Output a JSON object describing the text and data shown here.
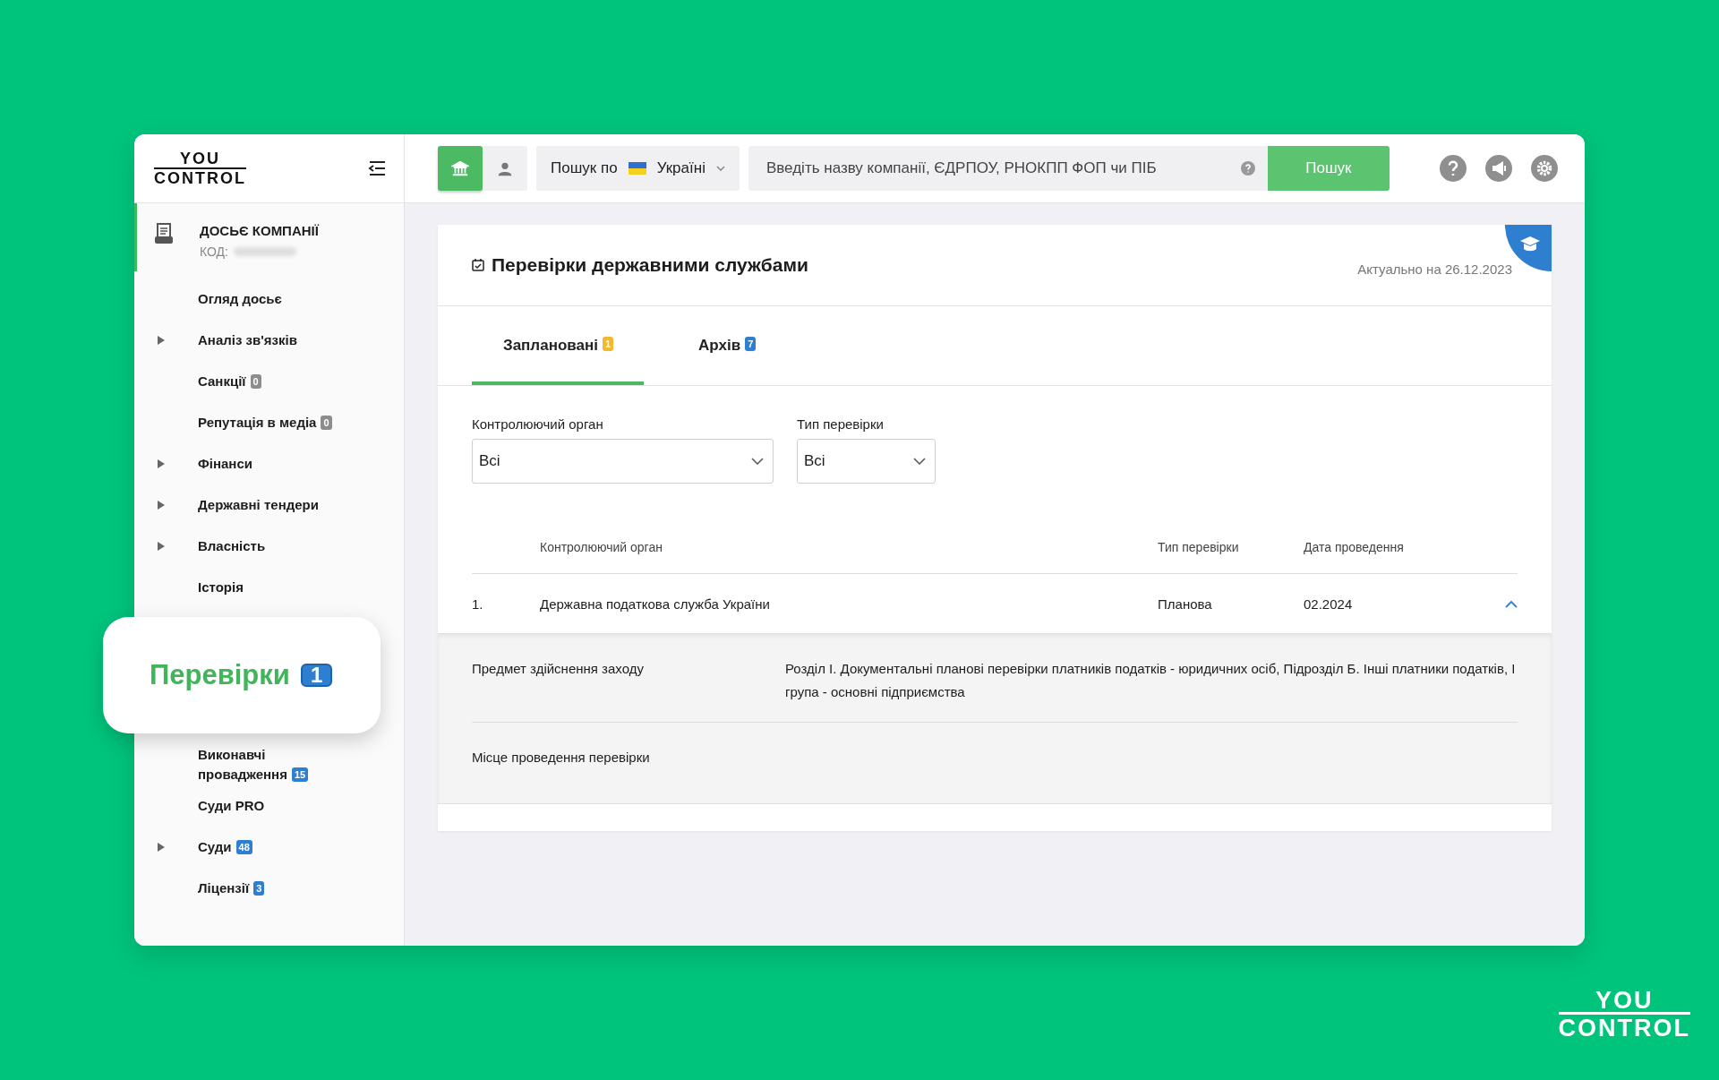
{
  "logo": {
    "top": "YOU",
    "bottom": "CONTROL"
  },
  "sidebar": {
    "dossier": {
      "title": "ДОСЬЄ КОМПАНІЇ",
      "code_label": "КОД:"
    },
    "items": [
      {
        "kind": "item",
        "label": "Огляд досьє",
        "expandable": false
      },
      {
        "kind": "item",
        "label": "Аналіз зв'язків",
        "expandable": true
      },
      {
        "kind": "item",
        "label": "Санкції",
        "expandable": false,
        "badge": "0",
        "color": "#8c8c8c"
      },
      {
        "kind": "item",
        "label": "Репутація в медіа",
        "expandable": false,
        "badge": "0",
        "color": "#8c8c8c"
      },
      {
        "kind": "item",
        "label": "Фінанси",
        "expandable": true
      },
      {
        "kind": "item",
        "label": "Державні тендери",
        "expandable": true
      },
      {
        "kind": "item",
        "label": "Власність",
        "expandable": true
      },
      {
        "kind": "item",
        "label": "Історія",
        "expandable": false
      },
      {
        "kind": "highlight",
        "label": "Перевірки",
        "badge": "1",
        "color": "#2f7fd0"
      },
      {
        "kind": "item",
        "label": "Виконавчі провадження",
        "expandable": false,
        "badge": "15",
        "color": "#2f7fd0"
      },
      {
        "kind": "item",
        "label": "Суди PRO",
        "expandable": false
      },
      {
        "kind": "item",
        "label": "Суди",
        "expandable": true,
        "badge": "48",
        "color": "#2f7fd0"
      },
      {
        "kind": "item",
        "label": "Ліцензії",
        "expandable": false,
        "badge": "3",
        "color": "#2f7fd0"
      }
    ]
  },
  "header": {
    "modes": [
      {
        "kind": "company",
        "selected": true
      },
      {
        "kind": "person",
        "selected": false
      }
    ],
    "scope_label": "Пошук по",
    "country": "Україні",
    "search": {
      "placeholder": "Введіть назву компанії, ЄДРПОУ, РНОКПП ФОП чи ПІБ"
    },
    "search_button": "Пошук"
  },
  "panel": {
    "title": "Перевірки державними службами",
    "updated": "Актуально на 26.12.2023",
    "tabs": [
      {
        "label": "Заплановані",
        "badge": "1",
        "color": "#f5b630",
        "selected": true
      },
      {
        "label": "Архів",
        "badge": "7",
        "color": "#2f7fd0",
        "selected": false
      }
    ],
    "filters": [
      {
        "label": "Контролюючий орган",
        "value": "Всі"
      },
      {
        "label": "Тип перевірки",
        "value": "Всі"
      }
    ],
    "table": {
      "columns": [
        "Контролюючий орган",
        "Тип перевірки",
        "Дата проведення"
      ],
      "rows": [
        {
          "index": "1.",
          "authority": "Державна податкова служба України",
          "type": "Планова",
          "date": "02.2024",
          "expanded": true,
          "details": [
            {
              "label": "Предмет здійснення заходу",
              "value": "Розділ І. Документальні планові перевірки платників податків - юридичних осіб, Підрозділ Б. Інші платники податків, І група - основні підприємства"
            },
            {
              "label": "Місце проведення перевірки"
            }
          ]
        }
      ]
    }
  },
  "brand_logo": {
    "top": "YOU",
    "bottom": "CONTROL"
  }
}
